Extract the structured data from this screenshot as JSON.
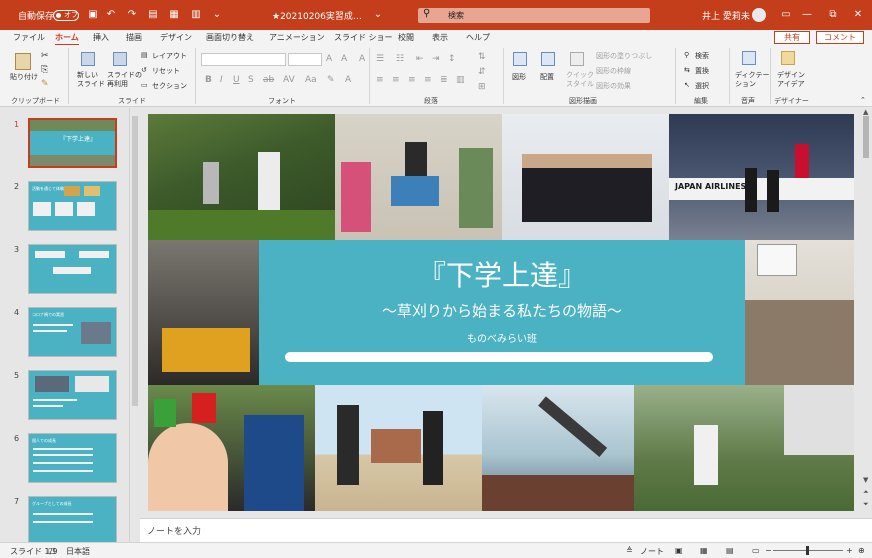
{
  "titlebar": {
    "autosave_label": "自動保存",
    "autosave_state": "オフ",
    "document_title": "★20210206実習成…",
    "search_placeholder": "検索",
    "user_name": "井上 愛莉未",
    "min": "—",
    "restore": "⧉",
    "close": "✕"
  },
  "tabs": [
    "ファイル",
    "ホーム",
    "挿入",
    "描画",
    "デザイン",
    "画面切り替え",
    "アニメーション",
    "スライド ショー",
    "校閲",
    "表示",
    "ヘルプ"
  ],
  "active_tab": "ホーム",
  "share_label": "共有",
  "comment_label": "コメント",
  "ribbon": {
    "clipboard": {
      "paste": "貼り付け",
      "group": "クリップボード"
    },
    "slides": {
      "new_slide": "新しい\nスライド",
      "reuse": "スライドの\n再利用",
      "layout": "レイアウト",
      "reset": "リセット",
      "section": "セクション",
      "group": "スライド"
    },
    "font": {
      "group": "フォント"
    },
    "paragraph": {
      "group": "段落"
    },
    "drawing": {
      "shape": "図形",
      "arrange": "配置",
      "quick_style": "クイック\nスタイル",
      "fill": "図形の塗りつぶし",
      "outline": "図形の枠線",
      "effects": "図形の効果",
      "group": "図形描画"
    },
    "editing": {
      "find": "検索",
      "replace": "置換",
      "select": "選択",
      "group": "編集"
    },
    "voice": {
      "dictate": "ディクテー\nション",
      "group": "音声"
    },
    "designer": {
      "ideas": "デザイン\nアイデア",
      "group": "デザイナー"
    }
  },
  "thumbnails": [
    {
      "num": "1",
      "title": "『下学上達』"
    },
    {
      "num": "2",
      "title": "活動を通じて体験"
    },
    {
      "num": "3",
      "title": ""
    },
    {
      "num": "4",
      "title": "コロナ禍での実習"
    },
    {
      "num": "5",
      "title": ""
    },
    {
      "num": "6",
      "title": "個人での成長"
    },
    {
      "num": "7",
      "title": "グループとしての成長"
    }
  ],
  "slide": {
    "title": "『下学上達』",
    "subtitle": "～草刈りから始まる私たちの物語～",
    "team": "ものべみらい班"
  },
  "notes_placeholder": "ノートを入力",
  "status": {
    "slide_info": "スライド 1/9",
    "language": "日本語",
    "notes_btn": "ノート"
  },
  "colors": {
    "accent": "#c43e1c",
    "slide_teal": "#4bb2c3"
  }
}
